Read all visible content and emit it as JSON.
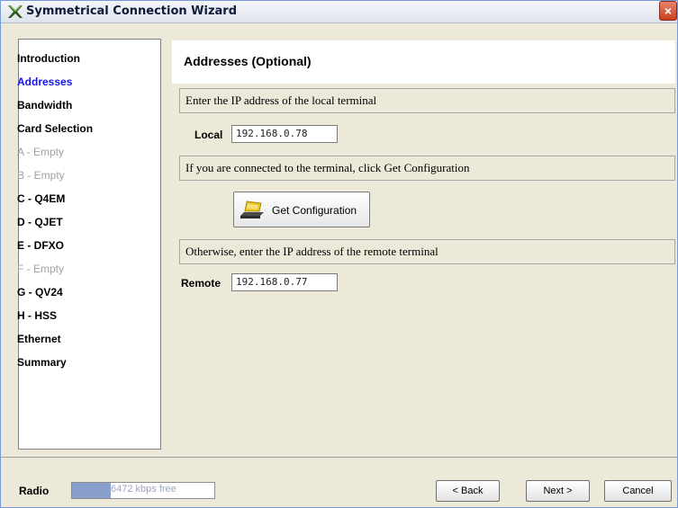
{
  "window": {
    "title": "Symmetrical Connection Wizard",
    "close_glyph": "×"
  },
  "sidebar": {
    "steps": [
      {
        "label": "Introduction",
        "state": "normal"
      },
      {
        "label": "Addresses",
        "state": "active"
      },
      {
        "label": "Bandwidth",
        "state": "normal"
      },
      {
        "label": "Card Selection",
        "state": "normal"
      },
      {
        "label": "A - Empty",
        "state": "disabled"
      },
      {
        "label": "B - Empty",
        "state": "disabled"
      },
      {
        "label": "C - Q4EM",
        "state": "normal"
      },
      {
        "label": "D - QJET",
        "state": "normal"
      },
      {
        "label": "E - DFXO",
        "state": "normal"
      },
      {
        "label": "F - Empty",
        "state": "disabled"
      },
      {
        "label": "G - QV24",
        "state": "normal"
      },
      {
        "label": "H - HSS",
        "state": "normal"
      },
      {
        "label": "Ethernet",
        "state": "normal"
      },
      {
        "label": "Summary",
        "state": "normal"
      }
    ]
  },
  "panel": {
    "title": "Addresses (Optional)",
    "local_instruction": "Enter the IP address of the local terminal",
    "local_label": "Local",
    "local_value": "192.168.0.78",
    "connected_instruction": "If you are connected to the terminal, click Get Configuration",
    "get_config_label": "Get Configuration",
    "remote_instruction": "Otherwise, enter the IP address of the remote terminal",
    "remote_label": "Remote",
    "remote_value": "192.168.0.77"
  },
  "footer": {
    "radio_label": "Radio",
    "bandwidth_text": "6472 kbps free",
    "bandwidth_fill_fraction": 0.27,
    "back_label": "< Back",
    "next_label": "Next >",
    "cancel_label": "Cancel"
  },
  "colors": {
    "active_step": "#1414e6",
    "disabled_step": "#a0a0a0",
    "close_button": "#c8411f"
  },
  "icons": {
    "title": "wizard-x-icon",
    "get_config": "terminal-device-icon"
  }
}
